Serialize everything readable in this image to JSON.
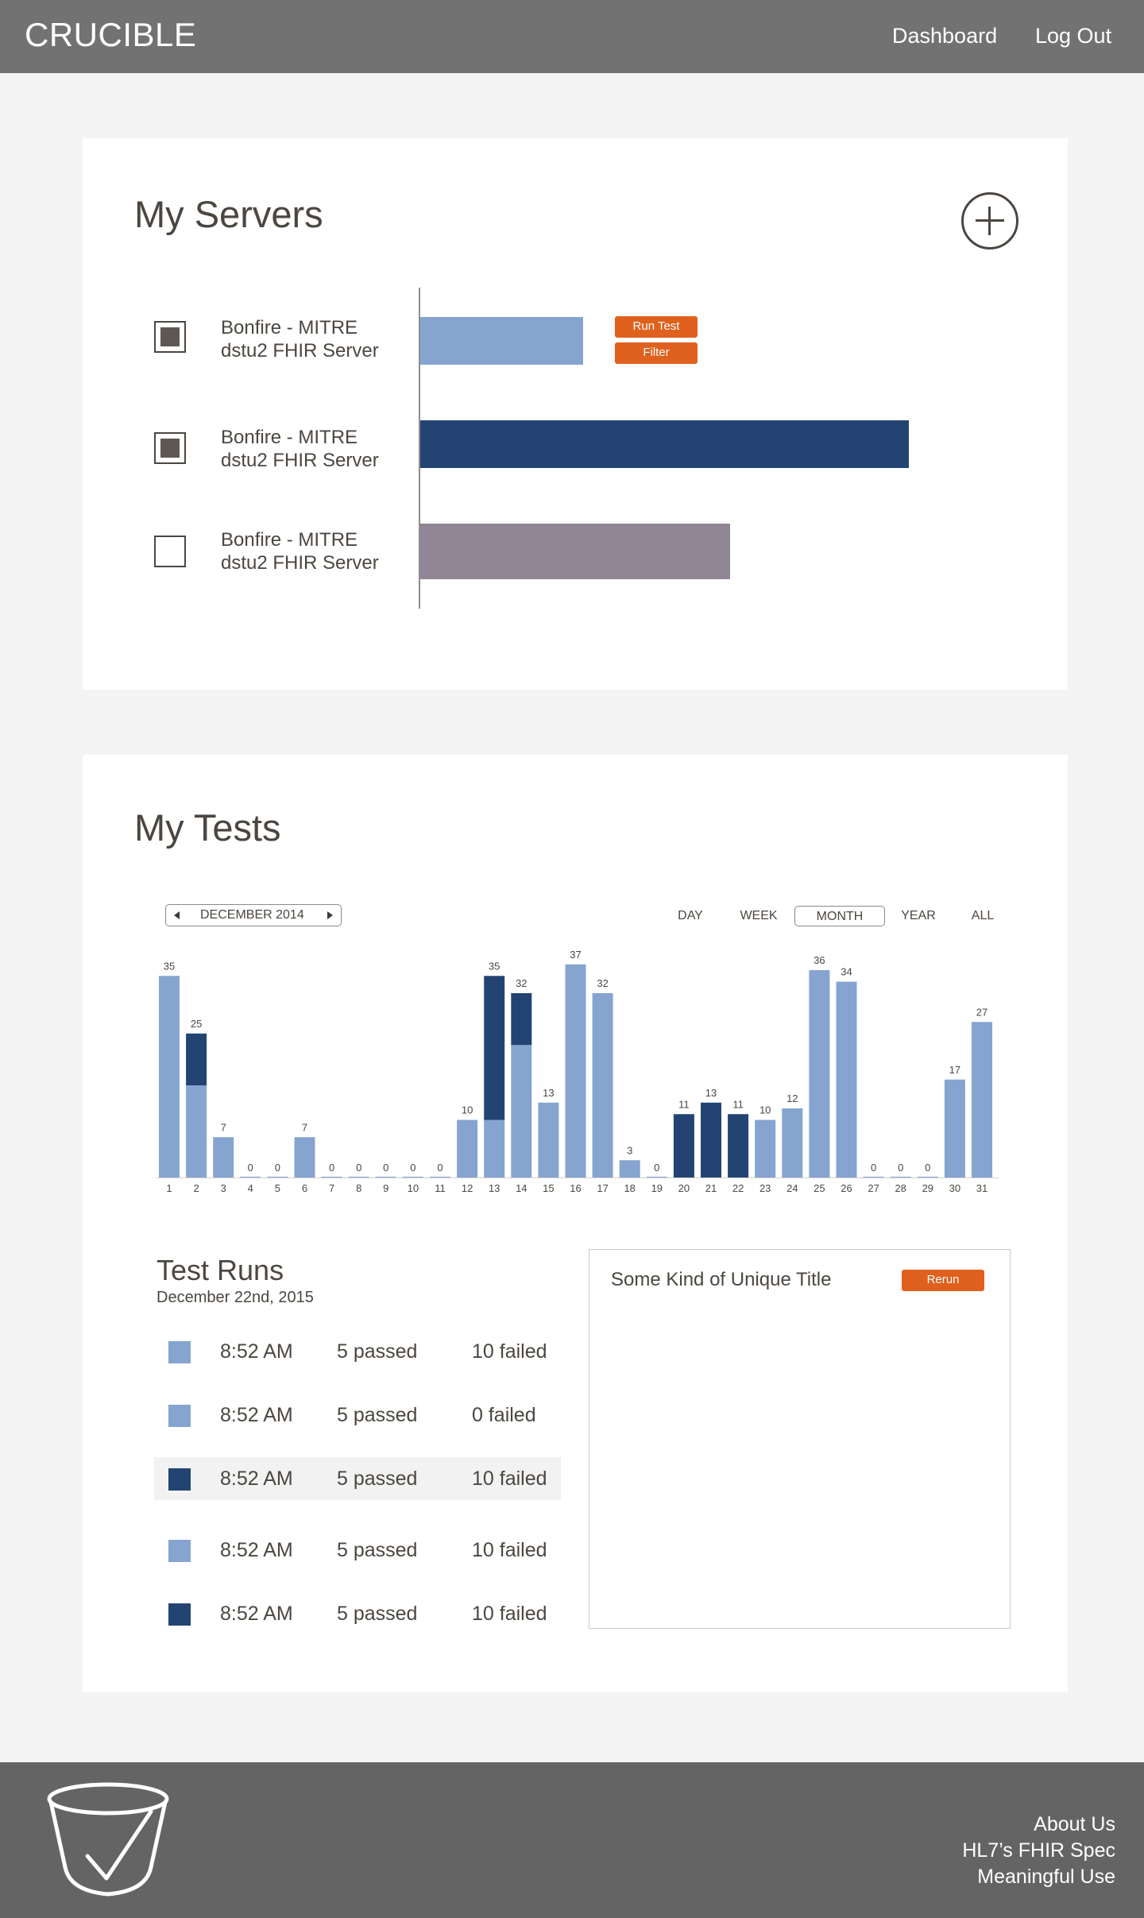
{
  "header": {
    "brand": "CRUCIBLE",
    "nav": {
      "dashboard": "Dashboard",
      "logout": "Log Out"
    }
  },
  "servers": {
    "title": "My Servers",
    "add_icon": "plus-circle-icon",
    "items": [
      {
        "name": "Bonfire - MITRE",
        "subtitle": "dstu2 FHIR Server",
        "checked": true,
        "bar_value": 0.25,
        "bar_color": "#86a4d0"
      },
      {
        "name": "Bonfire - MITRE",
        "subtitle": "dstu2 FHIR Server",
        "checked": true,
        "bar_value": 0.75,
        "bar_color": "#234472"
      },
      {
        "name": "Bonfire - MITRE",
        "subtitle": "dstu2 FHIR Server",
        "checked": false,
        "bar_value": 0.475,
        "bar_color": "#918696"
      }
    ],
    "actions": {
      "run_test": "Run Test",
      "filter": "Filter"
    }
  },
  "tests": {
    "title": "My Tests",
    "period": "DECEMBER 2014",
    "ranges": [
      "DAY",
      "WEEK",
      "MONTH",
      "YEAR",
      "ALL"
    ],
    "active_range": "MONTH"
  },
  "chart_data": {
    "type": "bar",
    "stacked": true,
    "categories": [
      "1",
      "2",
      "3",
      "4",
      "5",
      "6",
      "7",
      "8",
      "9",
      "10",
      "11",
      "12",
      "13",
      "14",
      "15",
      "16",
      "17",
      "18",
      "19",
      "20",
      "21",
      "22",
      "23",
      "24",
      "25",
      "26",
      "27",
      "28",
      "29",
      "30",
      "31"
    ],
    "totals": [
      35,
      25,
      7,
      0,
      0,
      7,
      0,
      0,
      0,
      0,
      0,
      10,
      35,
      32,
      13,
      37,
      32,
      3,
      0,
      11,
      13,
      11,
      10,
      12,
      36,
      34,
      0,
      0,
      0,
      17,
      27
    ],
    "series": [
      {
        "color": "#86a4d0",
        "values": [
          35,
          16,
          7,
          0,
          0,
          7,
          0,
          0,
          0,
          0,
          0,
          10,
          10,
          23,
          13,
          37,
          32,
          3,
          0,
          0,
          0,
          0,
          10,
          12,
          36,
          34,
          0,
          0,
          0,
          17,
          27
        ]
      },
      {
        "color": "#234472",
        "values": [
          0,
          9,
          0,
          0,
          0,
          0,
          0,
          0,
          0,
          0,
          0,
          0,
          25,
          9,
          0,
          0,
          0,
          0,
          0,
          11,
          13,
          11,
          0,
          0,
          0,
          0,
          0,
          0,
          0,
          0,
          0
        ]
      }
    ],
    "ylim": [
      0,
      40
    ],
    "grid": false
  },
  "test_runs": {
    "title": "Test Runs",
    "date": "December 22nd, 2015",
    "rows": [
      {
        "time": "8:52 AM",
        "passed": "5 passed",
        "failed": "10 failed",
        "color": "#86a4d0",
        "selected": false
      },
      {
        "time": "8:52 AM",
        "passed": "5 passed",
        "failed": "0 failed",
        "color": "#86a4d0",
        "selected": false
      },
      {
        "time": "8:52 AM",
        "passed": "5 passed",
        "failed": "10 failed",
        "color": "#234472",
        "selected": true
      },
      {
        "time": "8:52 AM",
        "passed": "5 passed",
        "failed": "10 failed",
        "color": "#86a4d0",
        "selected": false
      },
      {
        "time": "8:52 AM",
        "passed": "5 passed",
        "failed": "10 failed",
        "color": "#234472",
        "selected": false
      }
    ]
  },
  "detail": {
    "title": "Some Kind of Unique Title",
    "rerun": "Rerun"
  },
  "footer": {
    "logo_icon": "crucible-check-icon",
    "links": [
      "About Us",
      "HL7’s FHIR Spec",
      "Meaningful Use"
    ]
  }
}
